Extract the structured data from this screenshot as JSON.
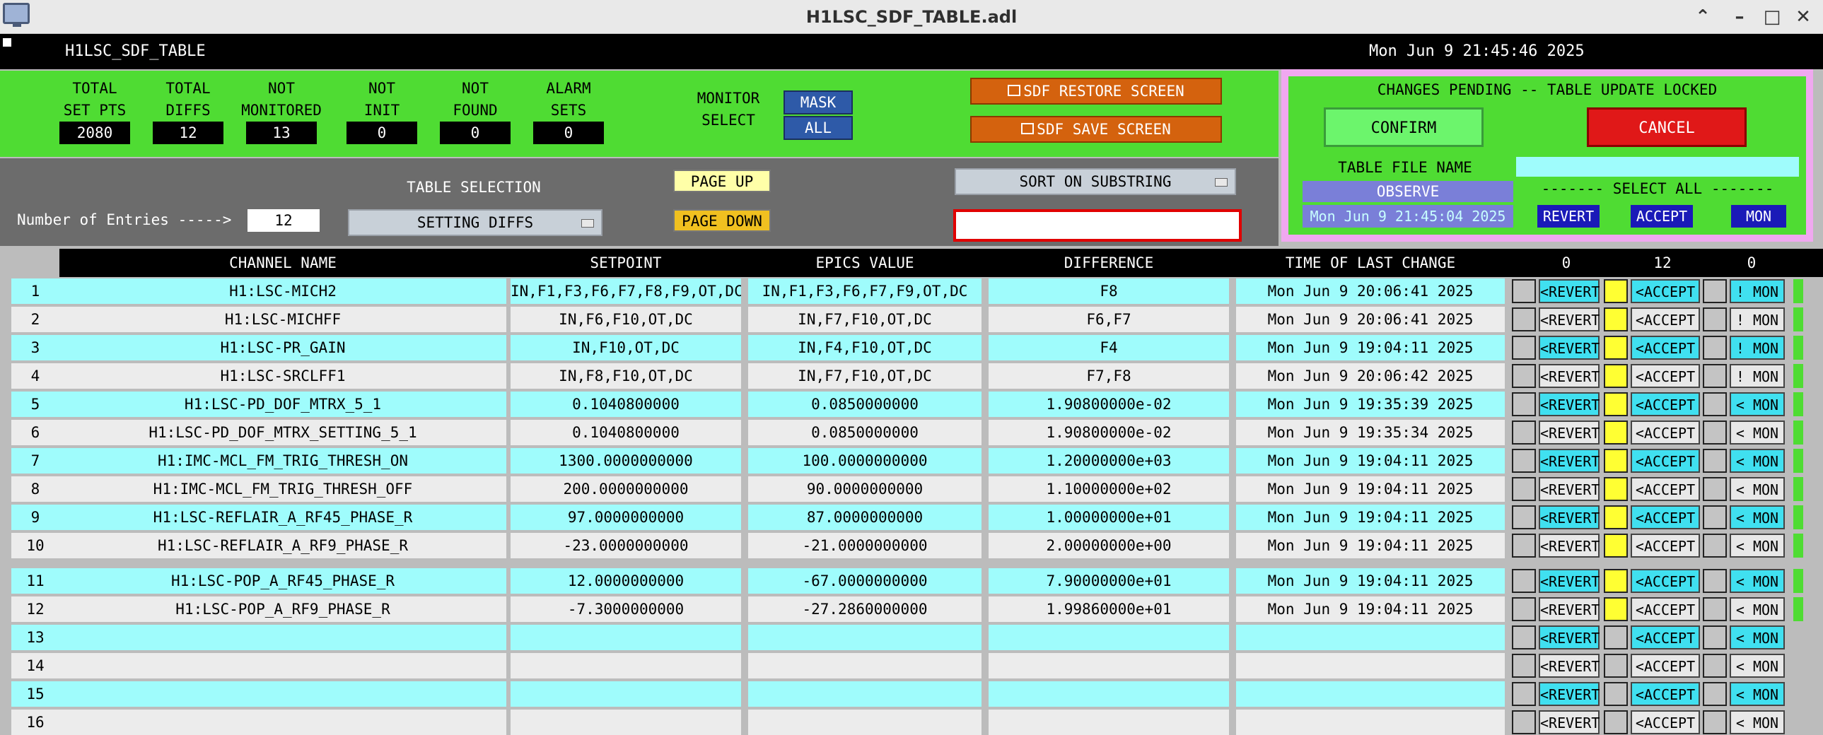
{
  "window": {
    "title": "H1LSC_SDF_TABLE.adl",
    "controls": [
      "⌃",
      "–",
      "□",
      "✕"
    ]
  },
  "header": {
    "name": "H1LSC_SDF_TABLE",
    "datetime": "Mon Jun  9 21:45:46 2025"
  },
  "stats": [
    {
      "label1": "TOTAL",
      "label2": "SET PTS",
      "value": "2080"
    },
    {
      "label1": "TOTAL",
      "label2": "DIFFS",
      "value": "12"
    },
    {
      "label1": "NOT",
      "label2": "MONITORED",
      "value": "13"
    },
    {
      "label1": "NOT",
      "label2": "INIT",
      "value": "0"
    },
    {
      "label1": "NOT",
      "label2": "FOUND",
      "value": "0"
    },
    {
      "label1": "ALARM",
      "label2": "SETS",
      "value": "0"
    }
  ],
  "monitor": {
    "label1": "MONITOR",
    "label2": "SELECT",
    "mask": "MASK",
    "all": "ALL"
  },
  "screens": {
    "restore": "SDF RESTORE SCREEN",
    "save": "SDF SAVE SCREEN"
  },
  "pending": {
    "status": "CHANGES PENDING -- TABLE UPDATE LOCKED",
    "confirm": "CONFIRM",
    "cancel": "CANCEL",
    "file_label": "TABLE FILE NAME",
    "file_name": "OBSERVE",
    "file_time": "Mon Jun  9 21:45:04 2025",
    "select_all": "------- SELECT ALL -------",
    "revert": "REVERT",
    "accept": "ACCEPT",
    "mon": "MON"
  },
  "selection": {
    "entries_label": "Number of Entries ----->",
    "entries_value": "12",
    "table_selection_label": "TABLE SELECTION",
    "table_selection_value": "SETTING DIFFS",
    "page_up": "PAGE UP",
    "page_down": "PAGE DOWN",
    "sort_label": "SORT ON SUBSTRING",
    "sort_value": ""
  },
  "table": {
    "columns": {
      "channel": "CHANNEL NAME",
      "setpoint": "SETPOINT",
      "epics": "EPICS VALUE",
      "difference": "DIFFERENCE",
      "time": "TIME OF LAST CHANGE",
      "count_revert": "0",
      "count_accept": "12",
      "count_mon": "0"
    },
    "rows": [
      {
        "num": "1",
        "channel": "H1:LSC-MICH2",
        "setpoint": "IN,F1,F3,F6,F7,F8,F9,OT,DC",
        "epics": "IN,F1,F3,F6,F7,F9,OT,DC",
        "difference": "F8",
        "time": "Mon Jun  9 20:06:41 2025",
        "revert": "<REVERT",
        "accept": "<ACCEPT",
        "mon": "! MON"
      },
      {
        "num": "2",
        "channel": "H1:LSC-MICHFF",
        "setpoint": "IN,F6,F10,OT,DC",
        "epics": "IN,F7,F10,OT,DC",
        "difference": "F6,F7",
        "time": "Mon Jun  9 20:06:41 2025",
        "revert": "<REVERT",
        "accept": "<ACCEPT",
        "mon": "! MON"
      },
      {
        "num": "3",
        "channel": "H1:LSC-PR_GAIN",
        "setpoint": "IN,F10,OT,DC",
        "epics": "IN,F4,F10,OT,DC",
        "difference": "F4",
        "time": "Mon Jun  9 19:04:11 2025",
        "revert": "<REVERT",
        "accept": "<ACCEPT",
        "mon": "! MON"
      },
      {
        "num": "4",
        "channel": "H1:LSC-SRCLFF1",
        "setpoint": "IN,F8,F10,OT,DC",
        "epics": "IN,F7,F10,OT,DC",
        "difference": "F7,F8",
        "time": "Mon Jun  9 20:06:42 2025",
        "revert": "<REVERT",
        "accept": "<ACCEPT",
        "mon": "! MON"
      },
      {
        "num": "5",
        "channel": "H1:LSC-PD_DOF_MTRX_5_1",
        "setpoint": "0.1040800000",
        "epics": "0.0850000000",
        "difference": "1.90800000e-02",
        "time": "Mon Jun  9 19:35:39 2025",
        "revert": "<REVERT",
        "accept": "<ACCEPT",
        "mon": "< MON"
      },
      {
        "num": "6",
        "channel": "H1:LSC-PD_DOF_MTRX_SETTING_5_1",
        "setpoint": "0.1040800000",
        "epics": "0.0850000000",
        "difference": "1.90800000e-02",
        "time": "Mon Jun  9 19:35:34 2025",
        "revert": "<REVERT",
        "accept": "<ACCEPT",
        "mon": "< MON"
      },
      {
        "num": "7",
        "channel": "H1:IMC-MCL_FM_TRIG_THRESH_ON",
        "setpoint": "1300.0000000000",
        "epics": "100.0000000000",
        "difference": "1.20000000e+03",
        "time": "Mon Jun  9 19:04:11 2025",
        "revert": "<REVERT",
        "accept": "<ACCEPT",
        "mon": "< MON"
      },
      {
        "num": "8",
        "channel": "H1:IMC-MCL_FM_TRIG_THRESH_OFF",
        "setpoint": "200.0000000000",
        "epics": "90.0000000000",
        "difference": "1.10000000e+02",
        "time": "Mon Jun  9 19:04:11 2025",
        "revert": "<REVERT",
        "accept": "<ACCEPT",
        "mon": "< MON"
      },
      {
        "num": "9",
        "channel": "H1:LSC-REFLAIR_A_RF45_PHASE_R",
        "setpoint": "97.0000000000",
        "epics": "87.0000000000",
        "difference": "1.00000000e+01",
        "time": "Mon Jun  9 19:04:11 2025",
        "revert": "<REVERT",
        "accept": "<ACCEPT",
        "mon": "< MON"
      },
      {
        "num": "10",
        "channel": "H1:LSC-REFLAIR_A_RF9_PHASE_R",
        "setpoint": "-23.0000000000",
        "epics": "-21.0000000000",
        "difference": "2.00000000e+00",
        "time": "Mon Jun  9 19:04:11 2025",
        "revert": "<REVERT",
        "accept": "<ACCEPT",
        "mon": "< MON"
      },
      {
        "num": "11",
        "channel": "H1:LSC-POP_A_RF45_PHASE_R",
        "setpoint": "12.0000000000",
        "epics": "-67.0000000000",
        "difference": "7.90000000e+01",
        "time": "Mon Jun  9 19:04:11 2025",
        "revert": "<REVERT",
        "accept": "<ACCEPT",
        "mon": "< MON"
      },
      {
        "num": "12",
        "channel": "H1:LSC-POP_A_RF9_PHASE_R",
        "setpoint": "-7.3000000000",
        "epics": "-27.2860000000",
        "difference": "1.99860000e+01",
        "time": "Mon Jun  9 19:04:11 2025",
        "revert": "<REVERT",
        "accept": "<ACCEPT",
        "mon": "< MON"
      },
      {
        "num": "13",
        "channel": "",
        "setpoint": "",
        "epics": "",
        "difference": "",
        "time": "",
        "revert": "<REVERT",
        "accept": "<ACCEPT",
        "mon": "< MON"
      },
      {
        "num": "14",
        "channel": "",
        "setpoint": "",
        "epics": "",
        "difference": "",
        "time": "",
        "revert": "<REVERT",
        "accept": "<ACCEPT",
        "mon": "< MON"
      },
      {
        "num": "15",
        "channel": "",
        "setpoint": "",
        "epics": "",
        "difference": "",
        "time": "",
        "revert": "<REVERT",
        "accept": "<ACCEPT",
        "mon": "< MON"
      },
      {
        "num": "16",
        "channel": "",
        "setpoint": "",
        "epics": "",
        "difference": "",
        "time": "",
        "revert": "<REVERT",
        "accept": "<ACCEPT",
        "mon": "< MON"
      }
    ]
  },
  "colors": {
    "panel_green": "#4fdc33",
    "row_cyan": "#9ffcfc",
    "row_gray": "#ececec",
    "revert_blue": "#40e0f0",
    "accept_yellow": "#ffff33",
    "cancel_red": "#e01818",
    "orange": "#d4620e"
  }
}
